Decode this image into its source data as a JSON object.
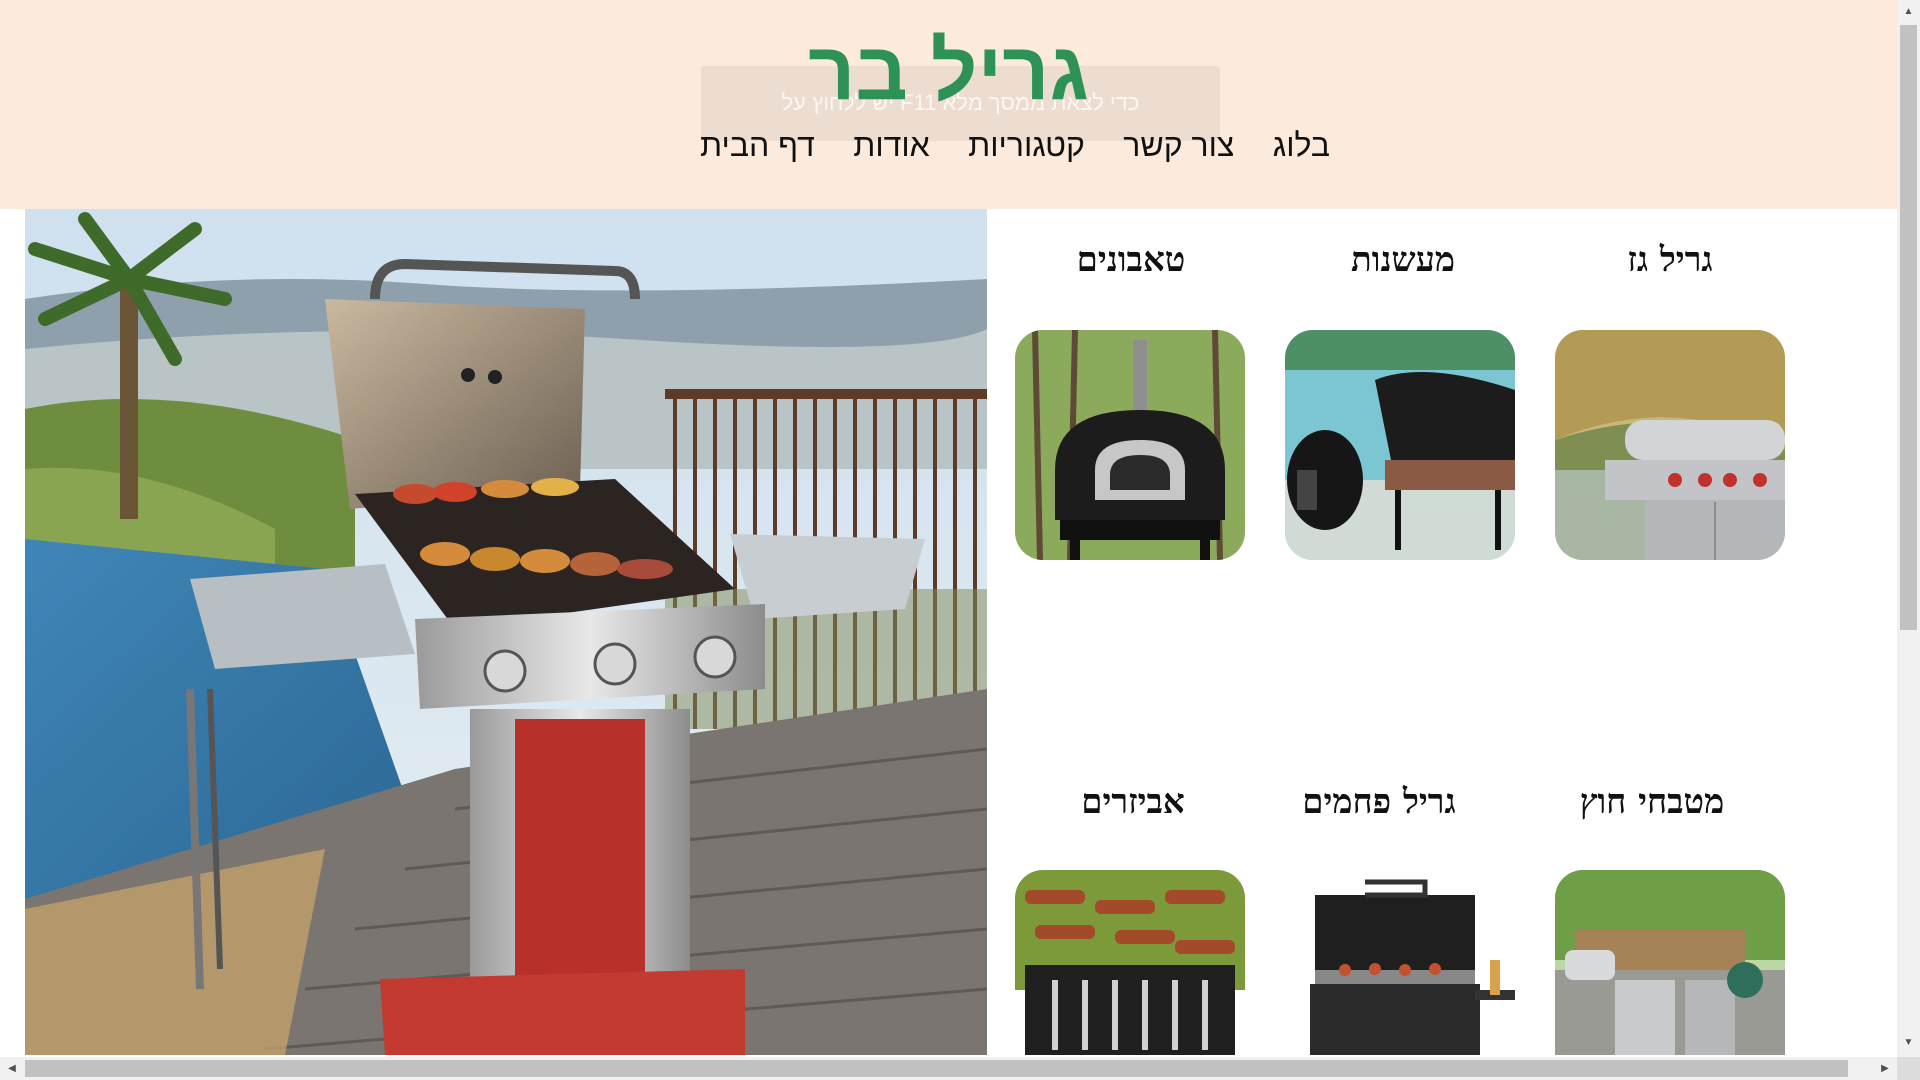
{
  "site": {
    "title": "גריל בר",
    "fullscreen_hint": "יש ללחוץ על F11 כדי לצאת ממסך מלא"
  },
  "nav": {
    "items": [
      {
        "label": "דף הבית"
      },
      {
        "label": "אודות"
      },
      {
        "label": "קטגוריות"
      },
      {
        "label": "צור קשר"
      },
      {
        "label": "בלוג"
      }
    ]
  },
  "categories": [
    {
      "title": "גריל גז",
      "icon": "gas-grill-image"
    },
    {
      "title": "מעשנות",
      "icon": "smoker-image"
    },
    {
      "title": "טאבונים",
      "icon": "pizza-oven-image"
    },
    {
      "title": "מטבחי חוץ",
      "icon": "outdoor-kitchen-image"
    },
    {
      "title": "גריל פחמים",
      "icon": "charcoal-grill-image"
    },
    {
      "title": "אביזרים",
      "icon": "accessories-image"
    }
  ],
  "colors": {
    "header_bg": "#fcebdd",
    "title_green": "#2e9155"
  }
}
